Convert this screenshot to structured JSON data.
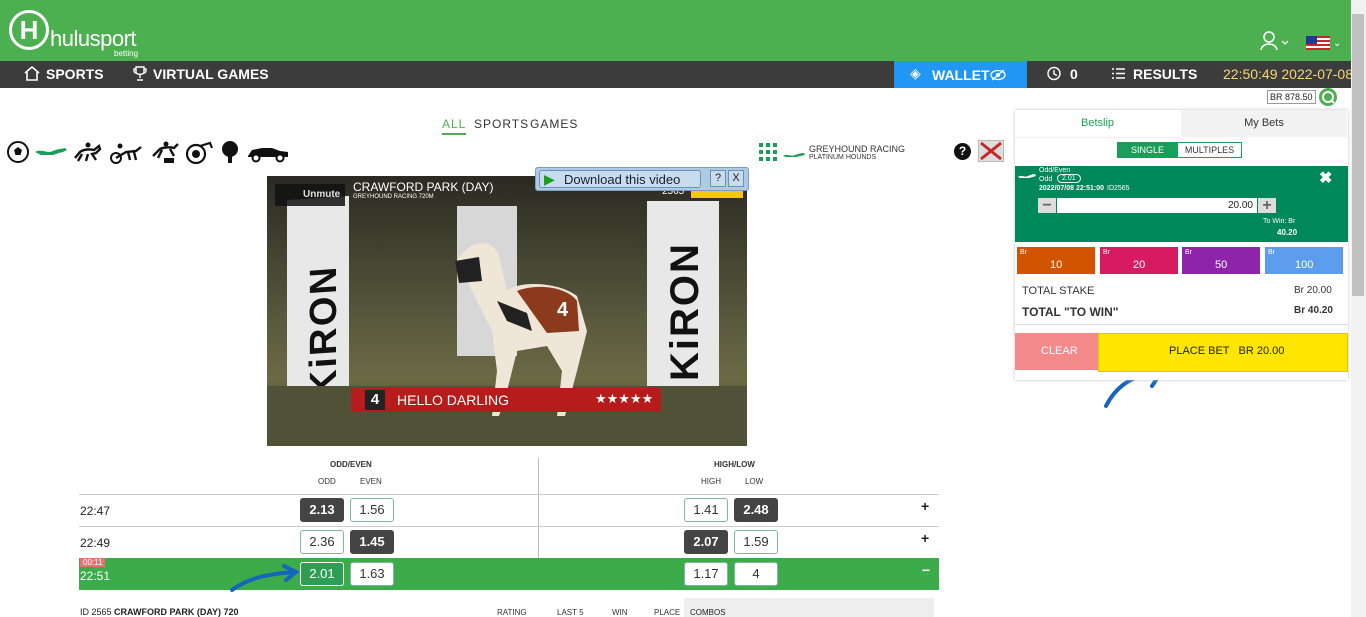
{
  "brand": {
    "logo_letter": "H",
    "name": "hulusport",
    "tagline": "betting"
  },
  "nav": {
    "sports": "SPORTS",
    "virtual_games": "VIRTUAL GAMES",
    "wallet": "WALLET",
    "history_count": "0",
    "results": "RESULTS",
    "clock": "22:50:49 2022-07-08"
  },
  "balance": "BR 878.50",
  "filters": {
    "all": "ALL",
    "sports": "SPORTS",
    "games": "GAMES"
  },
  "race_header": {
    "title": "GREYHOUND RACING",
    "subtitle": "PLATINUM HOUNDS"
  },
  "video": {
    "download": "Download this video",
    "help": "?",
    "close": "X",
    "unmute": "Unmute",
    "venue": "CRAWFORD PARK (DAY)",
    "meta": "GREYHOUND RACING 720M",
    "race_no": "2565",
    "runner_no": "4",
    "runner_name": "HELLO DARLING",
    "stars": "★★★★★"
  },
  "odds_table": {
    "group1": "ODD/EVEN",
    "group1_cols": [
      "ODD",
      "EVEN"
    ],
    "group2": "HIGH/LOW",
    "group2_cols": [
      "HIGH",
      "LOW"
    ],
    "rows": [
      {
        "time": "22:47",
        "odd": "2.13",
        "even": "1.56",
        "high": "1.41",
        "low": "2.48",
        "toggle": "+"
      },
      {
        "time": "22:49",
        "odd": "2.36",
        "even": "1.45",
        "high": "2.07",
        "low": "1.59",
        "toggle": "+"
      },
      {
        "time": "22:51",
        "countdown": "00:11",
        "odd": "2.01",
        "even": "1.63",
        "high": "1.17",
        "low": "4",
        "toggle": "−"
      }
    ]
  },
  "race_details": {
    "id_label": "ID 2565",
    "name": "CRAWFORD PARK (DAY) 720",
    "cols": [
      "RATING",
      "LAST 5",
      "WIN",
      "PLACE",
      "COMBOS"
    ]
  },
  "betslip": {
    "tab_betslip": "Betslip",
    "tab_mybets": "My Bets",
    "mode_single": "SINGLE",
    "mode_multiples": "MULTIPLES",
    "bet_market": "Odd/Even",
    "bet_selection": "Odd",
    "bet_odds": "2.01",
    "bet_datetime": "2022/07/08 22:51:00",
    "bet_id": "ID2565",
    "stake_value": "20.00",
    "to_win_label": "To Win: Br",
    "to_win_value": "40.20",
    "chips": [
      {
        "currency": "Br",
        "amount": "10",
        "color": "#d35400"
      },
      {
        "currency": "Br",
        "amount": "20",
        "color": "#d81b60"
      },
      {
        "currency": "Br",
        "amount": "50",
        "color": "#8e24aa"
      },
      {
        "currency": "Br",
        "amount": "100",
        "color": "#5c9ded"
      }
    ],
    "total_stake_label": "TOTAL STAKE",
    "total_stake_value": "Br 20.00",
    "total_win_label": "TOTAL \"TO WIN\"",
    "total_win_value": "Br 40.20",
    "clear": "CLEAR",
    "place_bet": "PLACE BET   BR 20.00"
  },
  "colors": {
    "brand_green": "#4caf50",
    "nav_dark": "#3c3c3c",
    "wallet_blue": "#2196f3",
    "bet_card": "#00875a",
    "place_bet": "#ffe600"
  }
}
